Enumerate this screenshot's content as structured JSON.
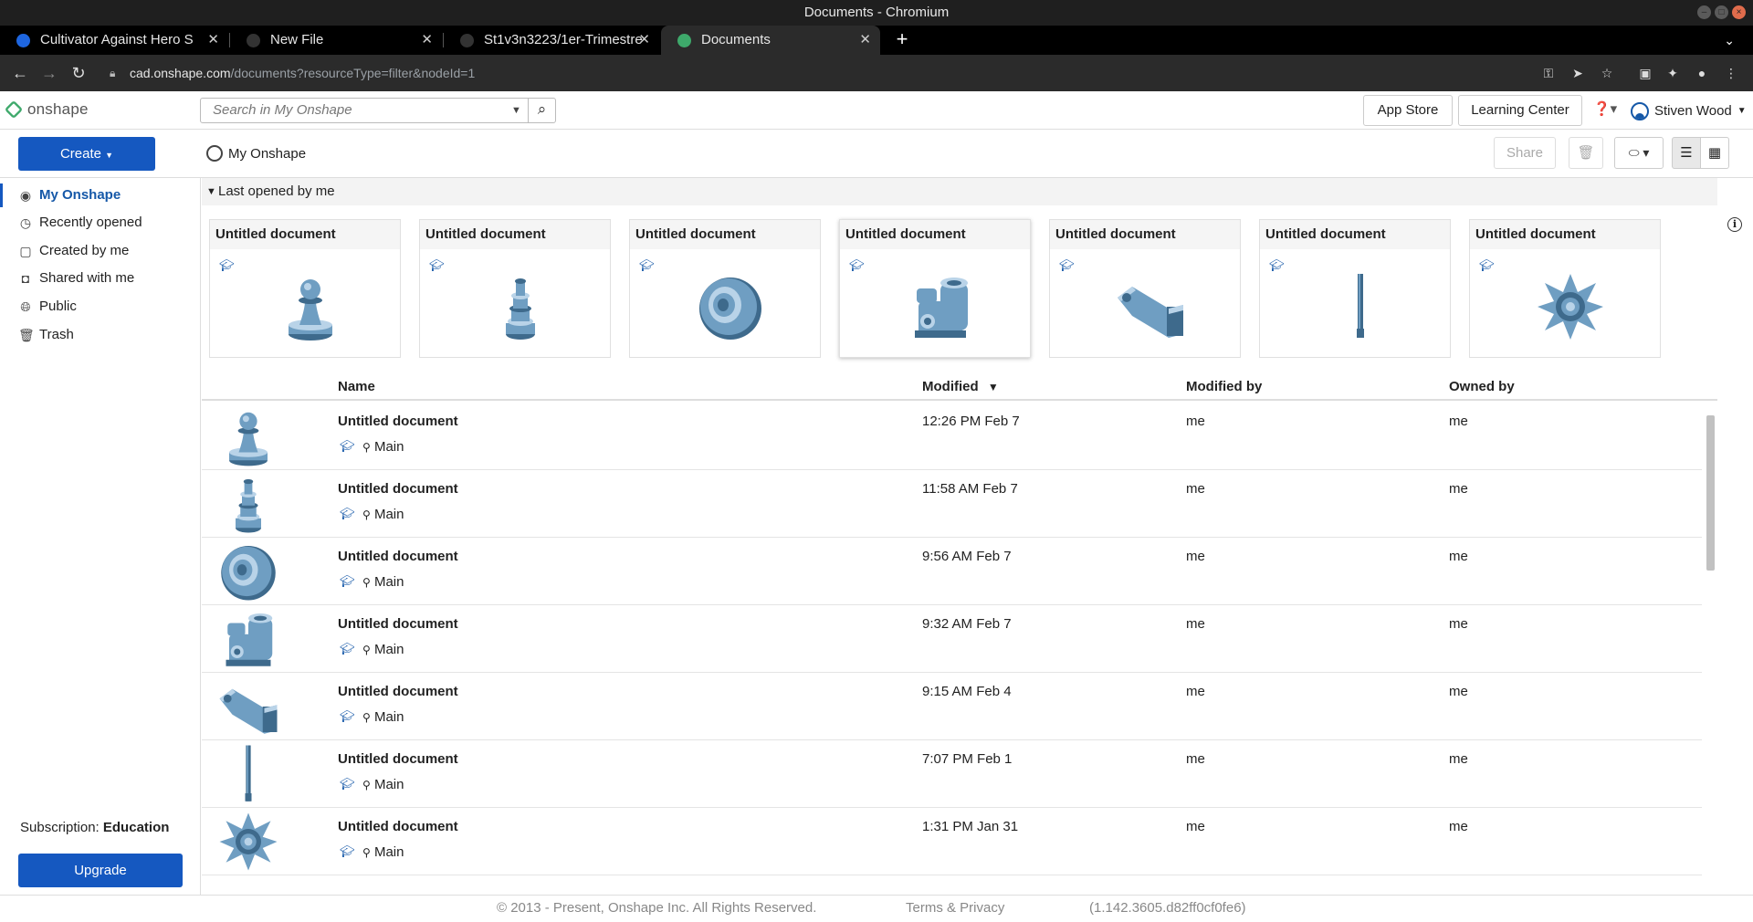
{
  "window": {
    "title": "Documents - Chromium"
  },
  "tabs": [
    {
      "label": "Cultivator Against Hero S",
      "favicon_color": "#1e66e0"
    },
    {
      "label": "New File",
      "favicon_color": "#333333"
    },
    {
      "label": "St1v3n3223/1er-Trimestre",
      "favicon_color": "#333333"
    },
    {
      "label": "Documents",
      "favicon_color": "#3ea96b"
    }
  ],
  "address": {
    "host": "cad.onshape.com",
    "path": "/documents?resourceType=filter&nodeId=1"
  },
  "app": {
    "logo_text": "onshape",
    "search_placeholder": "Search in My Onshape",
    "app_store": "App Store",
    "learning_center": "Learning Center",
    "user_name": "Stiven Wood",
    "create_label": "Create",
    "breadcrumb": "My Onshape",
    "share_label": "Share"
  },
  "sidebar": {
    "items": [
      {
        "label": "My Onshape",
        "icon": "user-circle-icon",
        "active": true
      },
      {
        "label": "Recently opened",
        "icon": "clock-icon"
      },
      {
        "label": "Created by me",
        "icon": "document-icon"
      },
      {
        "label": "Shared with me",
        "icon": "shared-user-icon"
      },
      {
        "label": "Public",
        "icon": "globe-icon"
      },
      {
        "label": "Trash",
        "icon": "trash-icon"
      }
    ],
    "subscription_label": "Subscription:",
    "subscription_value": "Education",
    "upgrade_label": "Upgrade"
  },
  "recent": {
    "header": "Last opened by me",
    "cards": [
      {
        "name": "Untitled document",
        "thumb": "pawn"
      },
      {
        "name": "Untitled document",
        "thumb": "tiered"
      },
      {
        "name": "Untitled document",
        "thumb": "wheel"
      },
      {
        "name": "Untitled document",
        "thumb": "bracket"
      },
      {
        "name": "Untitled document",
        "thumb": "arm"
      },
      {
        "name": "Untitled document",
        "thumb": "rod"
      },
      {
        "name": "Untitled document",
        "thumb": "star"
      }
    ]
  },
  "table": {
    "headers": {
      "name": "Name",
      "modified": "Modified",
      "modified_by": "Modified by",
      "owned_by": "Owned by"
    },
    "sort_indicator": "▼",
    "rows": [
      {
        "name": "Untitled document",
        "branch": "Main",
        "modified": "12:26 PM Feb 7",
        "modified_by": "me",
        "owned_by": "me",
        "thumb": "pawn"
      },
      {
        "name": "Untitled document",
        "branch": "Main",
        "modified": "11:58 AM Feb 7",
        "modified_by": "me",
        "owned_by": "me",
        "thumb": "tiered"
      },
      {
        "name": "Untitled document",
        "branch": "Main",
        "modified": "9:56 AM Feb 7",
        "modified_by": "me",
        "owned_by": "me",
        "thumb": "wheel"
      },
      {
        "name": "Untitled document",
        "branch": "Main",
        "modified": "9:32 AM Feb 7",
        "modified_by": "me",
        "owned_by": "me",
        "thumb": "bracket"
      },
      {
        "name": "Untitled document",
        "branch": "Main",
        "modified": "9:15 AM Feb 4",
        "modified_by": "me",
        "owned_by": "me",
        "thumb": "arm"
      },
      {
        "name": "Untitled document",
        "branch": "Main",
        "modified": "7:07 PM Feb 1",
        "modified_by": "me",
        "owned_by": "me",
        "thumb": "rod"
      },
      {
        "name": "Untitled document",
        "branch": "Main",
        "modified": "1:31 PM Jan 31",
        "modified_by": "me",
        "owned_by": "me",
        "thumb": "star"
      }
    ]
  },
  "footer": {
    "copyright": "© 2013 - Present, Onshape Inc. All Rights Reserved.",
    "terms": "Terms & Privacy",
    "version": "(1.142.3605.d82ff0cf0fe6)"
  },
  "colors": {
    "accent": "#1558c0",
    "part": "#6f9ec2",
    "brand": "#3ea96b"
  }
}
